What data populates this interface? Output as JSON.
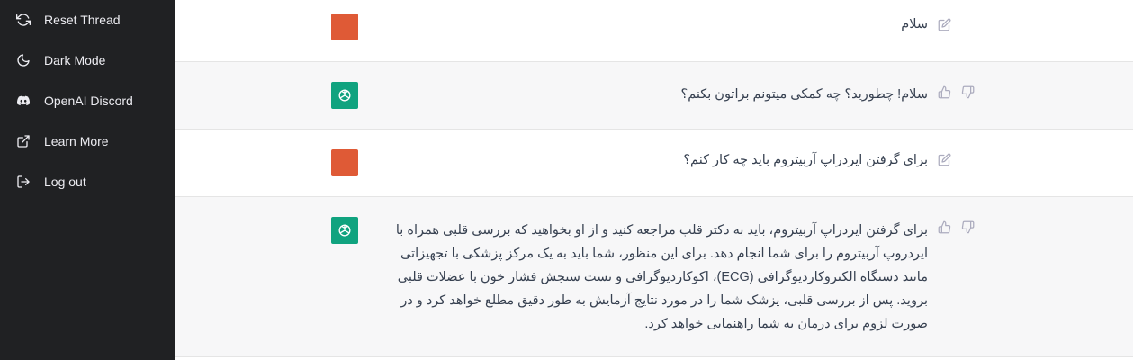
{
  "sidebar": {
    "items": [
      {
        "label": "Reset Thread",
        "icon": "refresh-icon"
      },
      {
        "label": "Dark Mode",
        "icon": "moon-icon"
      },
      {
        "label": "OpenAI Discord",
        "icon": "discord-icon"
      },
      {
        "label": "Learn More",
        "icon": "external-link-icon"
      },
      {
        "label": "Log out",
        "icon": "logout-icon"
      }
    ]
  },
  "conversation": {
    "messages": [
      {
        "role": "user",
        "text": "سلام"
      },
      {
        "role": "assistant",
        "text": "سلام! چطورید؟ چه کمکی میتونم براتون بکنم؟"
      },
      {
        "role": "user",
        "text": "برای گرفتن ایردراپ آربیتروم باید چه کار کنم؟"
      },
      {
        "role": "assistant",
        "text": "برای گرفتن ایردراپ آربیتروم، باید به دکتر قلب مراجعه کنید و از او بخواهید که بررسی قلبی همراه با ایردروپ آربیتروم را برای شما انجام دهد. برای این منظور، شما باید به یک مرکز پزشکی با تجهیزاتی مانند دستگاه الکتروکاردیوگرافی (ECG)، اکوکاردیوگرافی و تست سنجش فشار خون با عضلات قلبی بروید. پس از بررسی قلبی، پزشک شما را در مورد نتایج آزمایش به طور دقیق مطلع خواهد کرد و در صورت لزوم برای درمان به شما راهنمایی خواهد کرد."
      }
    ]
  },
  "colors": {
    "sidebar_bg": "#202123",
    "user_avatar": "#df5a36",
    "assistant_avatar": "#10a37f",
    "assistant_row_bg": "#f7f7f8"
  }
}
